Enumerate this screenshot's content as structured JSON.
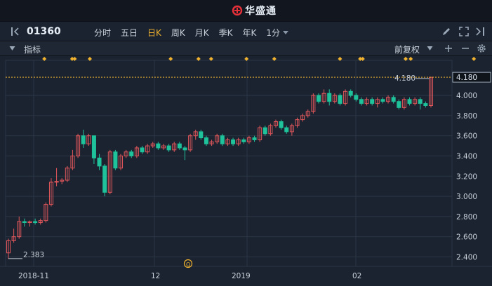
{
  "app": {
    "brand": "华盛通"
  },
  "toolbar": {
    "code": "01360",
    "periods": [
      {
        "label": "分时",
        "active": false
      },
      {
        "label": "五日",
        "active": false
      },
      {
        "label": "日K",
        "active": true
      },
      {
        "label": "周K",
        "active": false
      },
      {
        "label": "月K",
        "active": false
      },
      {
        "label": "季K",
        "active": false
      },
      {
        "label": "年K",
        "active": false
      },
      {
        "label": "1分",
        "active": false
      }
    ]
  },
  "subbar": {
    "indicator_label": "指标",
    "adjust_label": "前复权"
  },
  "colors": {
    "up": "#e0575b",
    "down": "#1fc29a",
    "accent": "#f0b22e",
    "bg": "#1b2330",
    "grid": "#2b3645"
  },
  "chart_data": {
    "type": "candlestick",
    "y_ticks": [
      "4.180",
      "4.000",
      "3.800",
      "3.600",
      "3.400",
      "3.200",
      "3.000",
      "2.800",
      "2.600",
      "2.400"
    ],
    "x_ticks": [
      "2018-11",
      "12",
      "2019",
      "02"
    ],
    "ylim": [
      2.32,
      4.32
    ],
    "high_label": "4.180",
    "low_label": "2.383",
    "marker_label": "Q",
    "candles": [
      [
        2.44,
        2.56,
        2.38,
        2.58
      ],
      [
        2.56,
        2.6,
        2.54,
        2.68
      ],
      [
        2.6,
        2.75,
        2.58,
        2.8
      ],
      [
        2.75,
        2.74,
        2.7,
        2.78
      ],
      [
        2.74,
        2.75,
        2.7,
        2.76
      ],
      [
        2.75,
        2.74,
        2.72,
        2.78
      ],
      [
        2.74,
        2.76,
        2.72,
        2.78
      ],
      [
        2.76,
        2.92,
        2.74,
        2.94
      ],
      [
        2.92,
        3.14,
        2.9,
        3.18
      ],
      [
        3.14,
        3.15,
        3.1,
        3.28
      ],
      [
        3.15,
        3.16,
        3.12,
        3.18
      ],
      [
        3.16,
        3.28,
        3.14,
        3.3
      ],
      [
        3.28,
        3.4,
        3.26,
        3.46
      ],
      [
        3.4,
        3.6,
        3.38,
        3.62
      ],
      [
        3.6,
        3.52,
        3.48,
        3.66
      ],
      [
        3.52,
        3.6,
        3.5,
        3.62
      ],
      [
        3.6,
        3.38,
        3.32,
        3.6
      ],
      [
        3.38,
        3.3,
        3.26,
        3.42
      ],
      [
        3.3,
        3.04,
        3.0,
        3.32
      ],
      [
        3.04,
        3.44,
        3.02,
        3.46
      ],
      [
        3.44,
        3.28,
        3.26,
        3.46
      ],
      [
        3.28,
        3.4,
        3.26,
        3.42
      ],
      [
        3.4,
        3.44,
        3.38,
        3.46
      ],
      [
        3.44,
        3.4,
        3.38,
        3.46
      ],
      [
        3.4,
        3.48,
        3.38,
        3.5
      ],
      [
        3.48,
        3.44,
        3.42,
        3.5
      ],
      [
        3.44,
        3.5,
        3.42,
        3.52
      ],
      [
        3.5,
        3.52,
        3.48,
        3.54
      ],
      [
        3.52,
        3.48,
        3.46,
        3.54
      ],
      [
        3.48,
        3.5,
        3.46,
        3.52
      ],
      [
        3.5,
        3.46,
        3.44,
        3.52
      ],
      [
        3.46,
        3.52,
        3.44,
        3.54
      ],
      [
        3.52,
        3.48,
        3.46,
        3.54
      ],
      [
        3.48,
        3.46,
        3.36,
        3.5
      ],
      [
        3.46,
        3.6,
        3.44,
        3.62
      ],
      [
        3.6,
        3.64,
        3.56,
        3.66
      ],
      [
        3.64,
        3.58,
        3.56,
        3.66
      ],
      [
        3.58,
        3.52,
        3.5,
        3.6
      ],
      [
        3.52,
        3.54,
        3.5,
        3.56
      ],
      [
        3.54,
        3.6,
        3.52,
        3.62
      ],
      [
        3.6,
        3.52,
        3.5,
        3.62
      ],
      [
        3.52,
        3.56,
        3.5,
        3.58
      ],
      [
        3.56,
        3.52,
        3.5,
        3.58
      ],
      [
        3.52,
        3.56,
        3.5,
        3.58
      ],
      [
        3.56,
        3.54,
        3.52,
        3.58
      ],
      [
        3.54,
        3.58,
        3.52,
        3.6
      ],
      [
        3.58,
        3.56,
        3.54,
        3.6
      ],
      [
        3.56,
        3.68,
        3.54,
        3.7
      ],
      [
        3.68,
        3.62,
        3.6,
        3.7
      ],
      [
        3.62,
        3.7,
        3.6,
        3.72
      ],
      [
        3.7,
        3.74,
        3.68,
        3.76
      ],
      [
        3.74,
        3.68,
        3.66,
        3.76
      ],
      [
        3.68,
        3.64,
        3.62,
        3.7
      ],
      [
        3.64,
        3.7,
        3.6,
        3.72
      ],
      [
        3.7,
        3.76,
        3.68,
        3.78
      ],
      [
        3.76,
        3.8,
        3.74,
        3.82
      ],
      [
        3.8,
        3.84,
        3.78,
        3.86
      ],
      [
        3.84,
        4.0,
        3.82,
        4.02
      ],
      [
        4.0,
        3.94,
        3.92,
        4.02
      ],
      [
        3.94,
        4.02,
        3.92,
        4.06
      ],
      [
        4.02,
        3.94,
        3.9,
        4.06
      ],
      [
        3.94,
        4.0,
        3.92,
        4.02
      ],
      [
        4.0,
        3.92,
        3.9,
        4.02
      ],
      [
        3.92,
        4.04,
        3.9,
        4.06
      ],
      [
        4.04,
        4.0,
        3.98,
        4.06
      ],
      [
        4.0,
        3.96,
        3.94,
        4.02
      ],
      [
        3.96,
        3.92,
        3.9,
        3.98
      ],
      [
        3.92,
        3.96,
        3.9,
        3.98
      ],
      [
        3.96,
        3.92,
        3.9,
        3.98
      ],
      [
        3.92,
        3.96,
        3.88,
        3.98
      ],
      [
        3.96,
        3.94,
        3.92,
        3.98
      ],
      [
        3.94,
        3.98,
        3.92,
        4.0
      ],
      [
        3.98,
        3.94,
        3.92,
        4.0
      ],
      [
        3.94,
        3.88,
        3.86,
        3.96
      ],
      [
        3.88,
        3.96,
        3.86,
        3.98
      ],
      [
        3.96,
        3.92,
        3.9,
        3.98
      ],
      [
        3.92,
        3.96,
        3.9,
        3.98
      ],
      [
        3.96,
        3.92,
        3.86,
        3.98
      ],
      [
        3.92,
        3.9,
        3.88,
        3.94
      ],
      [
        3.9,
        4.18,
        3.88,
        4.18
      ]
    ],
    "dividends": [
      7,
      18,
      19,
      25,
      57,
      68,
      73,
      87,
      98,
      124,
      132,
      133,
      150,
      152,
      177
    ]
  }
}
